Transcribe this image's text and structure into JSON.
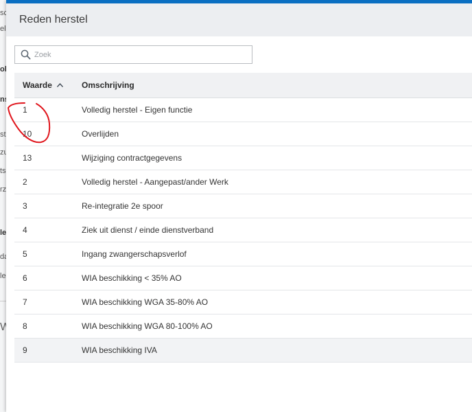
{
  "backdrop": {
    "fragments": [
      "sc",
      "el",
      "ol",
      "ns",
      "st",
      "zu",
      "ts",
      "rz",
      "le",
      "da",
      "le",
      "W"
    ]
  },
  "modal": {
    "title": "Reden herstel",
    "accent_color": "#0a6fc2"
  },
  "search": {
    "placeholder": "Zoek",
    "value": "",
    "icon": "search-icon"
  },
  "table": {
    "columns": [
      {
        "label": "Waarde",
        "sort": "ascending"
      },
      {
        "label": "Omschrijving"
      }
    ],
    "rows": [
      {
        "waarde": "1",
        "omschrijving": "Volledig herstel - Eigen functie"
      },
      {
        "waarde": "10",
        "omschrijving": "Overlijden"
      },
      {
        "waarde": "13",
        "omschrijving": "Wijziging contractgegevens"
      },
      {
        "waarde": "2",
        "omschrijving": "Volledig herstel - Aangepast/ander Werk"
      },
      {
        "waarde": "3",
        "omschrijving": "Re-integratie 2e spoor"
      },
      {
        "waarde": "4",
        "omschrijving": "Ziek uit dienst / einde dienstverband"
      },
      {
        "waarde": "5",
        "omschrijving": "Ingang zwangerschapsverlof"
      },
      {
        "waarde": "6",
        "omschrijving": "WIA beschikking < 35% AO"
      },
      {
        "waarde": "7",
        "omschrijving": "WIA beschikking WGA 35-80% AO"
      },
      {
        "waarde": "8",
        "omschrijving": "WIA beschikking WGA 80-100% AO"
      },
      {
        "waarde": "9",
        "omschrijving": "WIA beschikking IVA"
      }
    ]
  },
  "annotation": {
    "color": "#e0141b"
  }
}
